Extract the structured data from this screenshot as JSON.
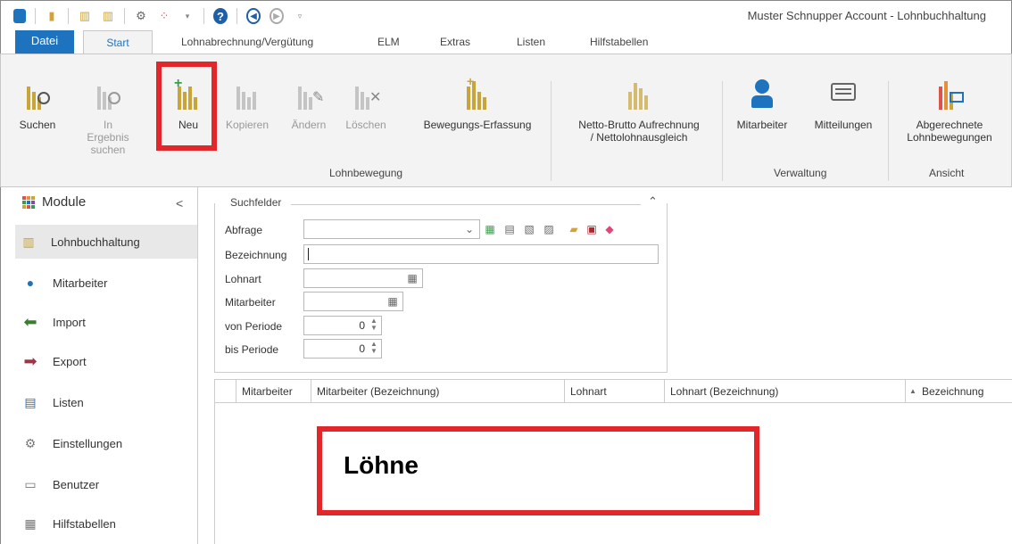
{
  "app_title": "Muster Schnupper Account - Lohnbuchhaltung",
  "qat": [
    "app-icon",
    "open-icon",
    "table-export-icon",
    "table-import-icon",
    "plugin-icon",
    "apps-icon",
    "help-icon",
    "back-icon",
    "forward-icon",
    "customize-icon"
  ],
  "ribbon_tabs": [
    "Datei",
    "Start",
    "Lohnabrechnung/Vergütung",
    "ELM",
    "Extras",
    "Listen",
    "Hilfstabellen"
  ],
  "ribbon": {
    "suchen": "Suchen",
    "in_ergebnis_1": "In Ergebnis",
    "in_ergebnis_2": "suchen",
    "neu": "Neu",
    "kopieren": "Kopieren",
    "aendern": "Ändern",
    "loeschen": "Löschen",
    "bewegungs": "Bewegungs-Erfassung",
    "netto_1": "Netto-Brutto Aufrechnung",
    "netto_2": "/ Nettolohnausgleich",
    "mitarbeiter": "Mitarbeiter",
    "mitteilungen": "Mitteilungen",
    "abgerechnete_1": "Abgerechnete",
    "abgerechnete_2": "Lohnbewegungen",
    "group_lohnbewegung": "Lohnbewegung",
    "group_verwaltung": "Verwaltung",
    "group_ansicht": "Ansicht"
  },
  "nav": {
    "title": "Module",
    "collapse": "<",
    "items": [
      {
        "label": "Lohnbuchhaltung"
      },
      {
        "label": "Mitarbeiter"
      },
      {
        "label": "Import"
      },
      {
        "label": "Export"
      },
      {
        "label": "Listen"
      },
      {
        "label": "Einstellungen"
      },
      {
        "label": "Benutzer"
      },
      {
        "label": "Hilfstabellen"
      }
    ]
  },
  "search": {
    "title": "Suchfelder",
    "abfrage": "Abfrage",
    "bezeichnung": "Bezeichnung",
    "lohnart": "Lohnart",
    "mitarbeiter": "Mitarbeiter",
    "von_periode": "von Periode",
    "bis_periode": "bis Periode",
    "von_value": "0",
    "bis_value": "0"
  },
  "grid": {
    "columns": [
      "Mitarbeiter",
      "Mitarbeiter (Bezeichnung)",
      "Lohnart",
      "Lohnart (Bezeichnung)",
      "Bezeichnung"
    ]
  },
  "callout": "Löhne",
  "colors": {
    "accent": "#1e73be",
    "highlight": "#e3262a",
    "gold": "#c9a437"
  }
}
